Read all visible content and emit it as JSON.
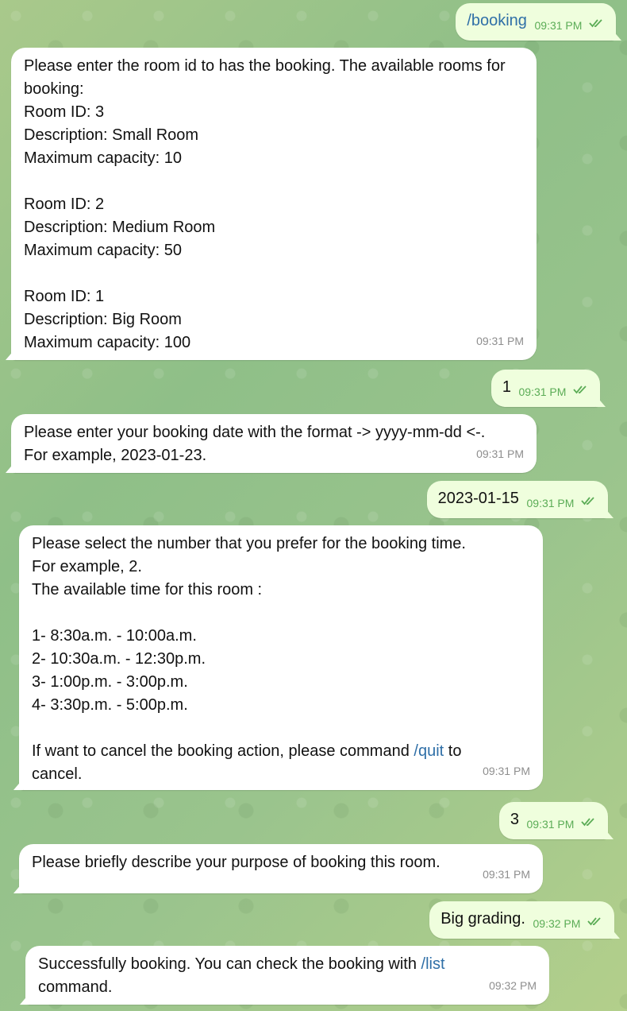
{
  "messages": [
    {
      "dir": "out",
      "text": "/booking",
      "time": "09:31 PM"
    },
    {
      "dir": "in",
      "text": "Please enter the room id to has the booking. The available rooms for booking:\nRoom ID: 3\nDescription: Small Room\nMaximum capacity: 10\n\nRoom ID: 2\nDescription: Medium Room\nMaximum capacity: 50\n\nRoom ID: 1\nDescription: Big Room\nMaximum capacity: 100",
      "time": "09:31 PM"
    },
    {
      "dir": "out",
      "text": "1",
      "time": "09:31 PM"
    },
    {
      "dir": "in",
      "text": "Please enter your booking date with the format -> yyyy-mm-dd <-.\nFor example, 2023-01-23.",
      "time": "09:31 PM"
    },
    {
      "dir": "out",
      "text": "2023-01-15",
      "time": "09:31 PM"
    },
    {
      "dir": "in",
      "text_before": "Please select the number that you prefer for the booking time.\nFor example, 2.\nThe available time for this room :\n\n1- 8:30a.m. - 10:00a.m.\n2- 10:30a.m. - 12:30p.m.\n3- 1:00p.m. - 3:00p.m.\n4- 3:30p.m. - 5:00p.m.\n\nIf want to cancel the booking action, please command ",
      "command": "/quit",
      "text_after": " to\ncancel.",
      "time": "09:31 PM"
    },
    {
      "dir": "out",
      "text": "3",
      "time": "09:31 PM"
    },
    {
      "dir": "in",
      "text": "Please briefly describe your purpose of booking this room.",
      "time": "09:31 PM"
    },
    {
      "dir": "out",
      "text": "Big grading.",
      "time": "09:32 PM"
    },
    {
      "dir": "in",
      "text_before": "Successfully booking. You can check the booking with ",
      "command": "/list",
      "text_after": "\ncommand.",
      "time": "09:32 PM"
    }
  ],
  "colors": {
    "incoming": "#ffffff",
    "outgoing": "#effedd",
    "command": "#2f6fa7",
    "outgoing_time": "#5bac56",
    "incoming_time": "#8e8e8e"
  },
  "icons": {
    "read_receipt": "double-check-icon"
  }
}
